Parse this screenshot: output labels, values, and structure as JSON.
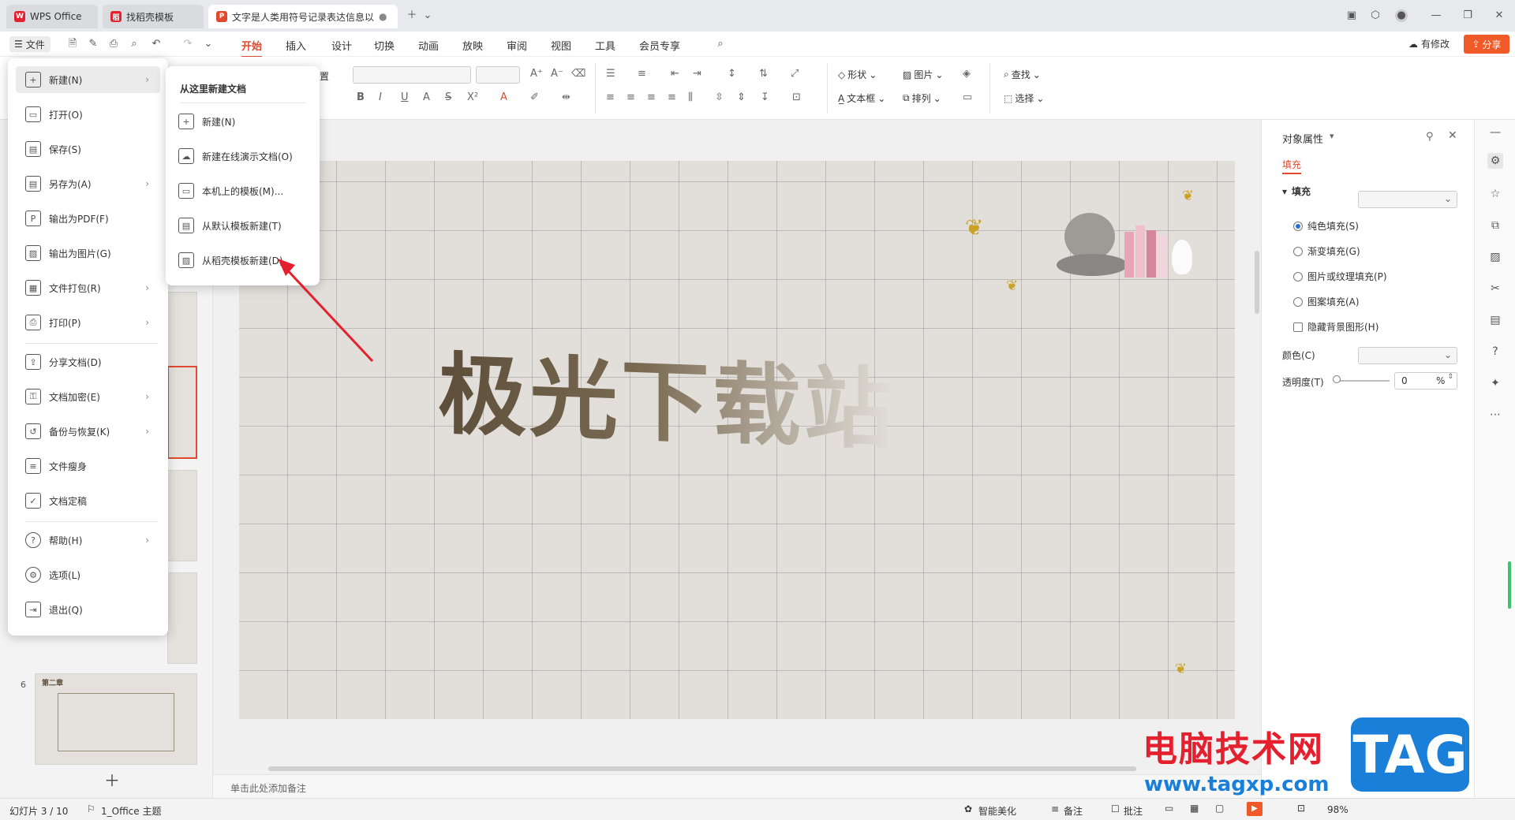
{
  "tabs": [
    {
      "label": "WPS Office"
    },
    {
      "label": "找稻壳模板"
    },
    {
      "label": "文字是人类用符号记录表达信息以"
    }
  ],
  "window": {
    "modified_label": "有修改",
    "share_label": "分享"
  },
  "menu": {
    "file_label": "文件",
    "tabs": [
      "开始",
      "插入",
      "设计",
      "切换",
      "动画",
      "放映",
      "审阅",
      "视图",
      "工具",
      "会员专享"
    ]
  },
  "toolbar": {
    "shape": "形状",
    "picture": "图片",
    "find": "查找",
    "textbox": "文本框",
    "arrange": "排列",
    "select": "选择",
    "reset_partial": "置"
  },
  "file_menu": {
    "items": [
      {
        "label": "新建(N)",
        "icon": "new-icon"
      },
      {
        "label": "打开(O)",
        "icon": "open-icon"
      },
      {
        "label": "保存(S)",
        "icon": "save-icon"
      },
      {
        "label": "另存为(A)",
        "icon": "save-as-icon"
      },
      {
        "label": "输出为PDF(F)",
        "icon": "pdf-icon"
      },
      {
        "label": "输出为图片(G)",
        "icon": "image-export-icon"
      },
      {
        "label": "文件打包(R)",
        "icon": "package-icon"
      },
      {
        "label": "打印(P)",
        "icon": "print-icon"
      },
      {
        "label": "分享文档(D)",
        "icon": "share-icon"
      },
      {
        "label": "文档加密(E)",
        "icon": "lock-icon"
      },
      {
        "label": "备份与恢复(K)",
        "icon": "backup-icon"
      },
      {
        "label": "文件瘦身",
        "icon": "slim-icon"
      },
      {
        "label": "文档定稿",
        "icon": "finalize-icon"
      },
      {
        "label": "帮助(H)",
        "icon": "help-icon"
      },
      {
        "label": "选项(L)",
        "icon": "options-icon"
      },
      {
        "label": "退出(Q)",
        "icon": "exit-icon"
      }
    ]
  },
  "submenu": {
    "title": "从这里新建文档",
    "items": [
      "新建(N)",
      "新建在线演示文档(O)",
      "本机上的模板(M)...",
      "从默认模板新建(T)",
      "从稻壳模板新建(D)"
    ]
  },
  "slide": {
    "title": "极光下载站",
    "thumb_number": "6",
    "thumb_heading": "第二章"
  },
  "notes": {
    "placeholder": "单击此处添加备注"
  },
  "panel": {
    "title": "对象属性",
    "tab": "填充",
    "section": "填充",
    "options": [
      "纯色填充(S)",
      "渐变填充(G)",
      "图片或纹理填充(P)",
      "图案填充(A)"
    ],
    "hide_bg": "隐藏背景图形(H)",
    "color_label": "颜色(C)",
    "transparency_label": "透明度(T)",
    "transparency_value": "0",
    "percent": "%"
  },
  "status": {
    "slide_info": "幻灯片 3 / 10",
    "theme": "1_Office 主题",
    "beautify": "智能美化",
    "notes": "备注",
    "comments": "批注",
    "zoom": "98%"
  },
  "watermark": {
    "cn": "电脑技术网",
    "url": "www.tagxp.com",
    "tag": "TAG"
  },
  "colors": {
    "accent": "#e0492f",
    "share_bg": "#f05a28",
    "watermark_red": "#e5202e",
    "watermark_blue": "#1a7fd8"
  }
}
